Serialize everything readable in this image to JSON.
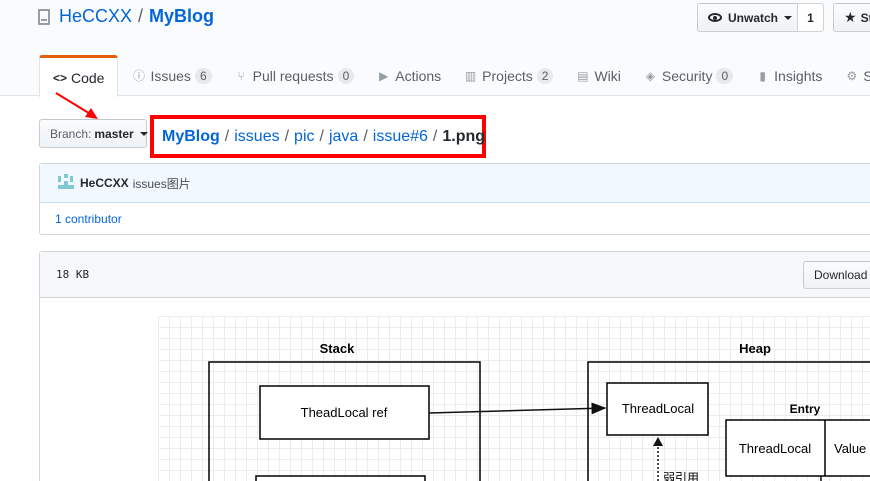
{
  "repo": {
    "owner": "HeCCXX",
    "separator": "/",
    "name": "MyBlog",
    "watch_label": "Unwatch",
    "watch_count": "1",
    "star_label": "St"
  },
  "tabs": [
    {
      "label": "Code",
      "icon": "code-icon",
      "selected": true
    },
    {
      "label": "Issues",
      "icon": "issue-icon",
      "count": "6"
    },
    {
      "label": "Pull requests",
      "icon": "pull-request-icon",
      "count": "0"
    },
    {
      "label": "Actions",
      "icon": "play-icon"
    },
    {
      "label": "Projects",
      "icon": "project-icon",
      "count": "2"
    },
    {
      "label": "Wiki",
      "icon": "book-icon"
    },
    {
      "label": "Security",
      "icon": "shield-icon",
      "count": "0"
    },
    {
      "label": "Insights",
      "icon": "graph-icon"
    },
    {
      "label": "S",
      "icon": "gear-icon"
    }
  ],
  "branch": {
    "label": "Branch:",
    "value": "master"
  },
  "breadcrumb": {
    "root": "MyBlog",
    "parts": [
      "issues",
      "pic",
      "java",
      "issue#6"
    ],
    "file": "1.png",
    "sep": "/"
  },
  "commit": {
    "author": "HeCCXX",
    "message": "issues图片",
    "contributors": "1 contributor"
  },
  "file": {
    "size": "18 KB",
    "download_label": "Download"
  },
  "diagram": {
    "stack_title": "Stack",
    "heap_title": "Heap",
    "ref_box": "TheadLocal ref",
    "heap_threadlocal": "ThreadLocal",
    "entry_title": "Entry",
    "entry_key": "ThreadLocal",
    "entry_value": "Value",
    "weak_ref": "弱引用"
  },
  "colors": {
    "link": "#0366d6",
    "annotation_red": "#ff0000",
    "tab_accent": "#e36209"
  }
}
